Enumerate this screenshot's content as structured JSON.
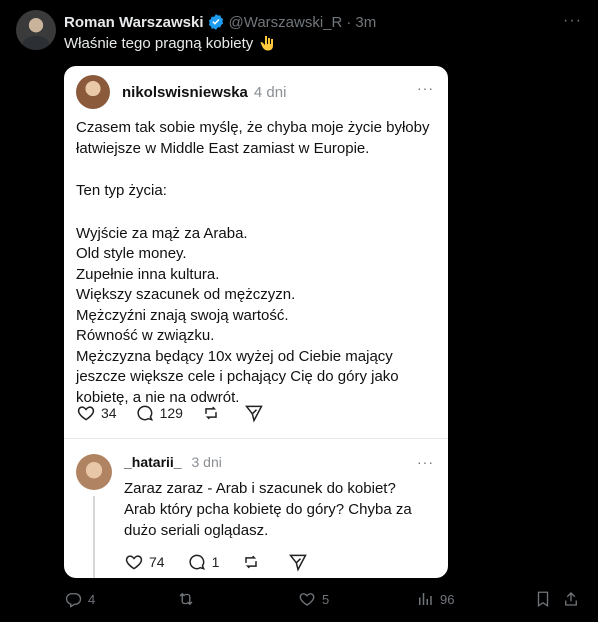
{
  "tweet": {
    "author_name": "Roman Warszawski",
    "handle": "@Warszawski_R",
    "separator": "·",
    "time": "3m",
    "more": "···",
    "text": "Właśnie tego pragną kobiety"
  },
  "quote": {
    "user": "nikolswisniewska",
    "time": "4 dni",
    "more": "···",
    "paragraph1": "Czasem tak sobie myślę, że chyba moje życie byłoby łatwiejsze w Middle East zamiast w Europie.",
    "paragraph2": "Ten typ życia:",
    "lines": [
      "Wyjście za mąż za Araba.",
      "Old style money.",
      "Zupełnie inna kultura.",
      "Większy szacunek od mężczyzn.",
      "Mężczyźni znają swoją wartość.",
      "Równość w związku.",
      "Mężczyzna będący 10x wyżej od Ciebie mający jeszcze większe cele i pchający Cię do góry jako kobietę, a nie na odwrót."
    ],
    "likes": "34",
    "replies": "129",
    "reply": {
      "user": "_hatarii_",
      "time": "3 dni",
      "more": "···",
      "text": "Zaraz zaraz - Arab i szacunek do kobiet? Arab który pcha kobietę do góry? Chyba za dużo seriali oglądasz.",
      "likes": "74",
      "replies": "1"
    }
  },
  "bottom_bar": {
    "replies": "4",
    "likes": "5",
    "views": "96"
  },
  "colors": {
    "background": "#000000",
    "verified_badge": "#1d9bf0",
    "muted_text": "#71767b"
  }
}
